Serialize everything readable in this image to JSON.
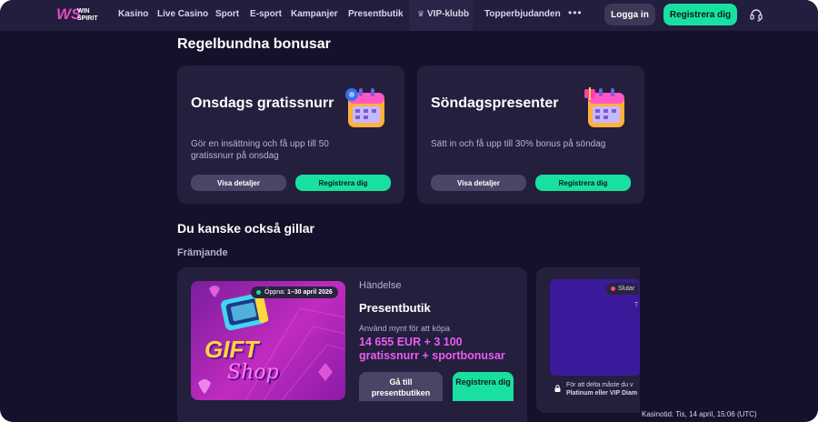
{
  "nav": {
    "logo_mark": "WS",
    "logo_line1": "WIN",
    "logo_line2": "SPIRIT",
    "items": [
      "Kasino",
      "Live Casino",
      "Sport",
      "E-sport",
      "Kampanjer",
      "Presentbutik"
    ],
    "vip": "VIP-klubb",
    "top_offers": "Topperbjudanden",
    "more": "•••",
    "login": "Logga in",
    "register": "Registrera dig"
  },
  "regular": {
    "title": "Regelbundna bonusar",
    "cards": [
      {
        "title": "Onsdags gratissnurr",
        "desc": "Gör en insättning och få upp till 50 gratissnurr på onsdag",
        "details": "Visa detaljer",
        "register": "Registrera dig"
      },
      {
        "title": "Söndagspresenter",
        "desc": "Sätt in och få upp till 30% bonus på söndag",
        "details": "Visa detaljer",
        "register": "Registrera dig"
      }
    ]
  },
  "also_like": {
    "title": "Du kanske också gillar",
    "subtitle": "Främjande",
    "promo": {
      "pill_label": "Öppna:",
      "pill_dates": "1–30 april 2026",
      "gift": "GIFT",
      "shop": "Shop",
      "event_label": "Händelse",
      "event_title": "Presentbutik",
      "event_desc": "Använd mynt för att köpa",
      "event_prize": "14 655 EUR + 3 100 gratissnurr + sportbonusar",
      "go_button": "Gå till presentbutiken",
      "register": "Registrera dig"
    },
    "card3": {
      "pill": "Slutar",
      "side_text": "T",
      "note_line1": "För att delta måste du v",
      "note_line2": "Platinum eller VIP Diam"
    }
  },
  "status": {
    "casino_time": "Kasinotid: Tis, 14 april, 15:06 (UTC)"
  },
  "colors": {
    "background": "#14112a",
    "nav": "#221e3e",
    "card": "#231f3d",
    "accent_green": "#18e0a0",
    "accent_pink": "#ea5cf2"
  }
}
